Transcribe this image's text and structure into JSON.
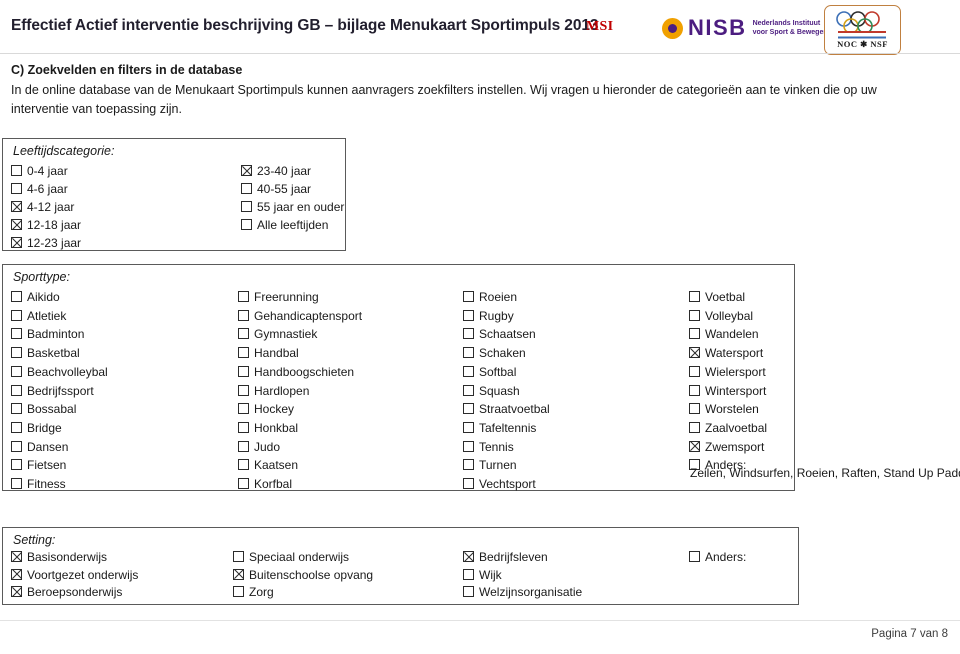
{
  "header": {
    "title": "Effectief Actief interventie beschrijving GB – bijlage Menukaart Sportimpuls 2013",
    "msi_mark": "MSI",
    "nisb_wordmark": "NISB",
    "nisb_tagline_line1": "Nederlands Instituut",
    "nisb_tagline_line2": "voor Sport & Bewegen",
    "nocnsf_label": "NOC ✱ NSF",
    "title_color": "#221f2e",
    "msi_color": "#c00000",
    "nisb_color": "#4c1d80",
    "nisb_dot_color": "#f0a000",
    "nocnsf_border_color": "#c08040"
  },
  "intro": {
    "heading": "C) Zoekvelden en filters in de database",
    "paragraph": "In de online database van de Menukaart Sportimpuls kunnen aanvragers zoekfilters instellen. Wij vragen u hieronder de categorieën aan te vinken die op uw interventie van toepassing zijn."
  },
  "age": {
    "legend": "Leeftijdscategorie:",
    "column1": [
      {
        "label": "0-4 jaar",
        "checked": false
      },
      {
        "label": "4-6 jaar",
        "checked": false
      },
      {
        "label": "4-12 jaar",
        "checked": true
      },
      {
        "label": "12-18 jaar",
        "checked": true
      },
      {
        "label": "12-23 jaar",
        "checked": true
      }
    ],
    "column2": [
      {
        "label": "23-40 jaar",
        "checked": true
      },
      {
        "label": "40-55 jaar",
        "checked": false
      },
      {
        "label": "55 jaar en ouder",
        "checked": false
      },
      {
        "label": "Alle leeftijden",
        "checked": false
      }
    ]
  },
  "sport": {
    "legend": "Sporttype:",
    "column1": [
      {
        "label": "Aikido",
        "checked": false
      },
      {
        "label": "Atletiek",
        "checked": false
      },
      {
        "label": "Badminton",
        "checked": false
      },
      {
        "label": "Basketbal",
        "checked": false
      },
      {
        "label": "Beachvolleybal",
        "checked": false
      },
      {
        "label": "Bedrijfssport",
        "checked": false
      },
      {
        "label": "Bossabal",
        "checked": false
      },
      {
        "label": "Bridge",
        "checked": false
      },
      {
        "label": "Dansen",
        "checked": false
      },
      {
        "label": "Fietsen",
        "checked": false
      },
      {
        "label": "Fitness",
        "checked": false
      }
    ],
    "column2": [
      {
        "label": "Freerunning",
        "checked": false
      },
      {
        "label": "Gehandicaptensport",
        "checked": false
      },
      {
        "label": "Gymnastiek",
        "checked": false
      },
      {
        "label": "Handbal",
        "checked": false
      },
      {
        "label": "Handboogschieten",
        "checked": false
      },
      {
        "label": "Hardlopen",
        "checked": false
      },
      {
        "label": "Hockey",
        "checked": false
      },
      {
        "label": "Honkbal",
        "checked": false
      },
      {
        "label": "Judo",
        "checked": false
      },
      {
        "label": "Kaatsen",
        "checked": false
      },
      {
        "label": "Korfbal",
        "checked": false
      }
    ],
    "column3": [
      {
        "label": "Roeien",
        "checked": false
      },
      {
        "label": "Rugby",
        "checked": false
      },
      {
        "label": "Schaatsen",
        "checked": false
      },
      {
        "label": "Schaken",
        "checked": false
      },
      {
        "label": "Softbal",
        "checked": false
      },
      {
        "label": "Squash",
        "checked": false
      },
      {
        "label": "Straatvoetbal",
        "checked": false
      },
      {
        "label": "Tafeltennis",
        "checked": false
      },
      {
        "label": "Tennis",
        "checked": false
      },
      {
        "label": "Turnen",
        "checked": false
      },
      {
        "label": "Vechtsport",
        "checked": false
      }
    ],
    "column4": [
      {
        "label": "Voetbal",
        "checked": false
      },
      {
        "label": "Volleybal",
        "checked": false
      },
      {
        "label": "Wandelen",
        "checked": false
      },
      {
        "label": "Watersport",
        "checked": true
      },
      {
        "label": "Wielersport",
        "checked": false
      },
      {
        "label": "Wintersport",
        "checked": false
      },
      {
        "label": "Worstelen",
        "checked": false
      },
      {
        "label": "Zaalvoetbal",
        "checked": false
      },
      {
        "label": "Zwemsport",
        "checked": true
      },
      {
        "label": "Anders:",
        "checked": false
      }
    ],
    "anders_value": "Zeilen, Windsurfen, Roeien, Raften, Stand Up Paddle,"
  },
  "setting": {
    "legend": "Setting:",
    "column1": [
      {
        "label": "Basisonderwijs",
        "checked": true
      },
      {
        "label": "Voortgezet onderwijs",
        "checked": true
      },
      {
        "label": "Beroepsonderwijs",
        "checked": true
      }
    ],
    "column2": [
      {
        "label": "Speciaal onderwijs",
        "checked": false
      },
      {
        "label": "Buitenschoolse opvang",
        "checked": true
      },
      {
        "label": "Zorg",
        "checked": false
      }
    ],
    "column3": [
      {
        "label": "Bedrijfsleven",
        "checked": true
      },
      {
        "label": "Wijk",
        "checked": false
      },
      {
        "label": "Welzijnsorganisatie",
        "checked": false
      }
    ],
    "column4": [
      {
        "label": "Anders:",
        "checked": false
      }
    ]
  },
  "footer": {
    "page_text": "Pagina 7 van 8"
  }
}
